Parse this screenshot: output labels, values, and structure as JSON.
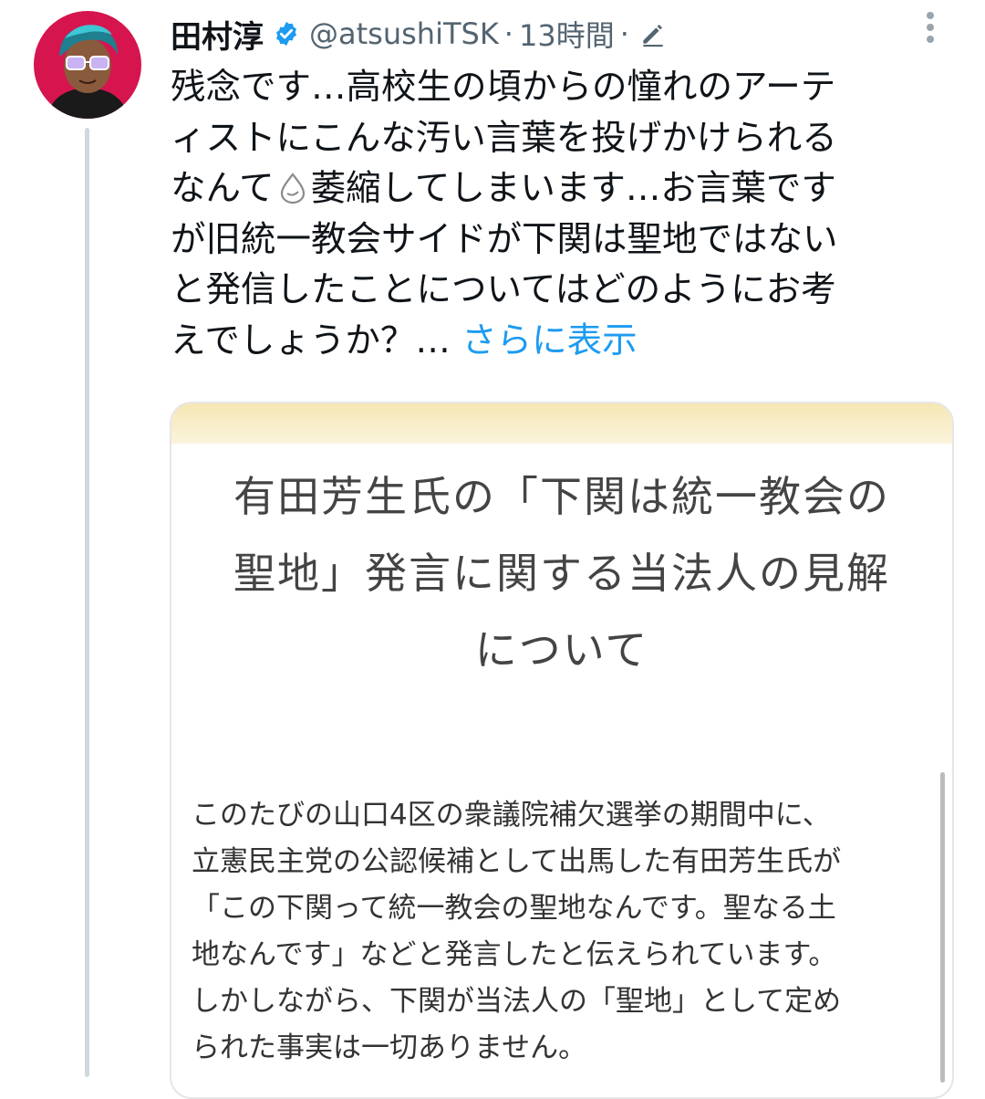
{
  "tweet": {
    "author": {
      "name": "田村淳",
      "handle": "@atsushiTSK",
      "verified": true
    },
    "separator": "·",
    "time": "13時間",
    "text_lines": [
      "残念です…高校生の頃からの憧れのアーテ",
      "ィストにこんな汚い言葉を投げかけられる",
      "なんて",
      "萎縮してしまいます…お言葉です",
      "が旧統一教会サイドが下関は聖地ではない",
      "と発信したことについてはどのようにお考",
      "えでしょうか？…"
    ],
    "show_more": "さらに表示",
    "inline_emoji": "sweat-droplet-icon"
  },
  "card": {
    "title_lines": [
      "有田芳生氏の「下関は統一教会の",
      "聖地」発言に関する当法人の見解",
      "について"
    ],
    "body_lines": [
      "このたびの山口4区の衆議院補欠選挙の期間中に、",
      "立憲民主党の公認候補として出馬した有田芳生氏が",
      "「この下関って統一教会の聖地なんです。聖なる土",
      "地なんです」などと発言したと伝えられています。",
      "しかしながら、下関が当法人の「聖地」として定め",
      "られた事実は一切ありません。"
    ]
  },
  "colors": {
    "link": "#1d9bf0",
    "verified": "#1d9bf0",
    "secondary_text": "#536471",
    "avatar_bg": "#d6154f"
  }
}
